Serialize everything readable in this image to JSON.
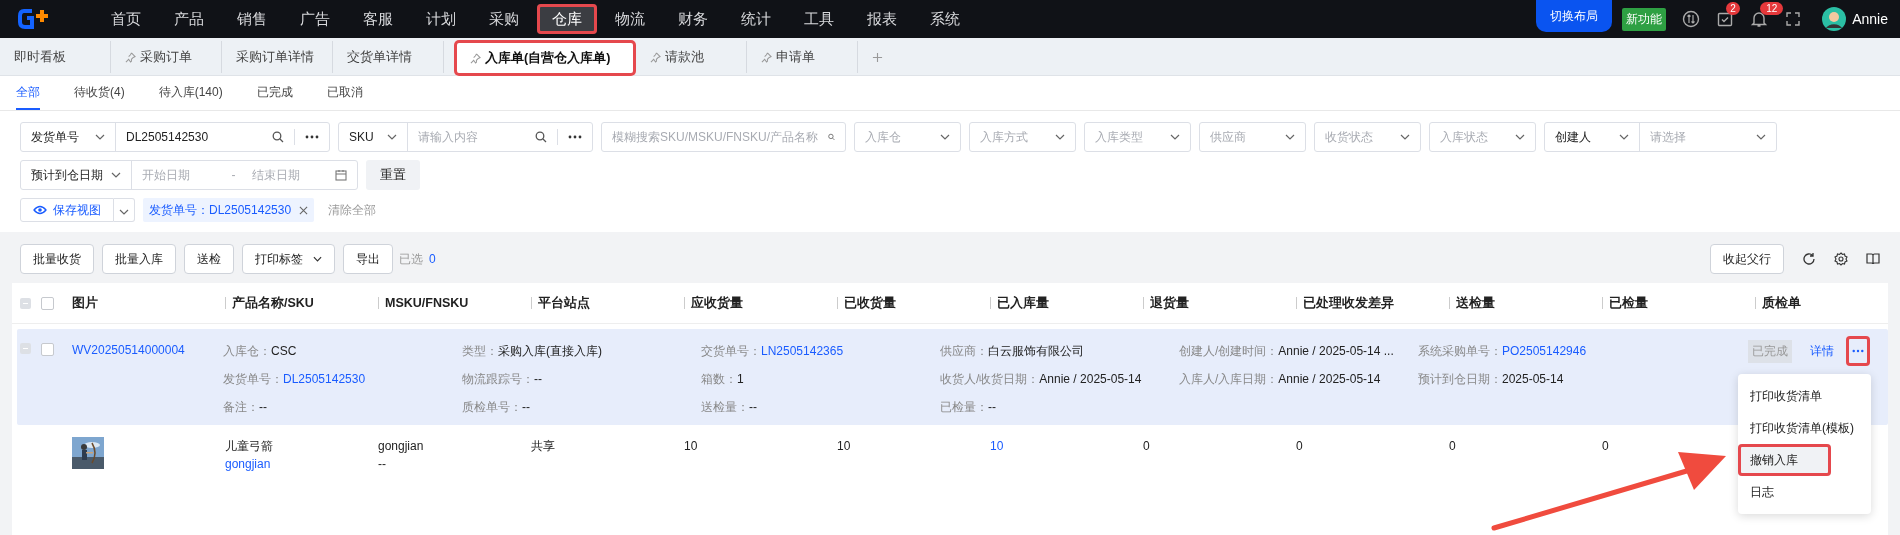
{
  "nav": {
    "items": [
      {
        "label": "首页",
        "selected": false,
        "highlighted": false
      },
      {
        "label": "产品",
        "selected": false,
        "highlighted": false
      },
      {
        "label": "销售",
        "selected": false,
        "highlighted": false
      },
      {
        "label": "广告",
        "selected": false,
        "highlighted": false
      },
      {
        "label": "客服",
        "selected": false,
        "highlighted": false
      },
      {
        "label": "计划",
        "selected": false,
        "highlighted": false
      },
      {
        "label": "采购",
        "selected": false,
        "highlighted": false
      },
      {
        "label": "仓库",
        "selected": true,
        "highlighted": true
      },
      {
        "label": "物流",
        "selected": false,
        "highlighted": false
      },
      {
        "label": "财务",
        "selected": false,
        "highlighted": false
      },
      {
        "label": "统计",
        "selected": false,
        "highlighted": false
      },
      {
        "label": "工具",
        "selected": false,
        "highlighted": false
      },
      {
        "label": "报表",
        "selected": false,
        "highlighted": false
      },
      {
        "label": "系统",
        "selected": false,
        "highlighted": false
      }
    ],
    "layout_button": "切换布局",
    "new_feature": "新功能",
    "task_badge": "2",
    "notice_badge": "12",
    "user": "Annie"
  },
  "tabs": [
    {
      "label": "即时看板",
      "pinned": false,
      "selected": false,
      "highlighted": false
    },
    {
      "label": "采购订单",
      "pinned": true,
      "selected": false,
      "highlighted": false
    },
    {
      "label": "采购订单详情",
      "pinned": false,
      "selected": false,
      "highlighted": false
    },
    {
      "label": "交货单详情",
      "pinned": false,
      "selected": false,
      "highlighted": false
    },
    {
      "label": "入库单(自营仓入库单)",
      "pinned": true,
      "selected": true,
      "highlighted": true
    },
    {
      "label": "请款池",
      "pinned": true,
      "selected": false,
      "highlighted": false
    },
    {
      "label": "申请单",
      "pinned": true,
      "selected": false,
      "highlighted": false
    }
  ],
  "status_tabs": [
    {
      "label": "全部",
      "selected": true
    },
    {
      "label": "待收货(4)",
      "selected": false
    },
    {
      "label": "待入库(140)",
      "selected": false
    },
    {
      "label": "已完成",
      "selected": false
    },
    {
      "label": "已取消",
      "selected": false
    }
  ],
  "filters": [
    [
      {
        "kind": "combo",
        "select": "发货单号",
        "value": "DL2505142530"
      },
      {
        "kind": "combo",
        "select": "SKU",
        "placeholder": "请输入内容"
      },
      {
        "kind": "search",
        "placeholder": "模糊搜索SKU/MSKU/FNSKU/产品名称"
      },
      {
        "kind": "select",
        "placeholder": "入库仓"
      },
      {
        "kind": "select",
        "placeholder": "入库方式"
      },
      {
        "kind": "select",
        "placeholder": "入库类型"
      },
      {
        "kind": "select",
        "placeholder": "供应商"
      },
      {
        "kind": "select",
        "placeholder": "收货状态"
      },
      {
        "kind": "select",
        "placeholder": "入库状态"
      },
      {
        "kind": "pair",
        "select": "创建人",
        "placeholder": "请选择"
      }
    ],
    [
      {
        "kind": "date_range",
        "select": "预计到仓日期",
        "start_placeholder": "开始日期",
        "separator": "-",
        "end_placeholder": "结束日期"
      },
      {
        "kind": "button",
        "label": "重置"
      }
    ]
  ],
  "view": {
    "save_button": "保存视图",
    "tag": "发货单号：DL2505142530",
    "clear": "清除全部"
  },
  "toolbar": {
    "buttons": [
      {
        "label": "批量收货",
        "dropdown": false
      },
      {
        "label": "批量入库",
        "dropdown": false
      },
      {
        "label": "送检",
        "dropdown": false
      },
      {
        "label": "打印标签",
        "dropdown": true
      },
      {
        "label": "导出",
        "dropdown": false
      }
    ],
    "selected_label": "已选",
    "selected_count": "0",
    "collapse_button": "收起父行"
  },
  "table": {
    "columns": [
      "图片",
      "产品名称/SKU",
      "MSKU/FNSKU",
      "平台站点",
      "应收货量",
      "已收货量",
      "已入库量",
      "退货量",
      "已处理收发差异",
      "送检量",
      "已检量",
      "质检单"
    ],
    "all_checked": false,
    "parent": {
      "code": "WV20250514000004",
      "checked": false,
      "groups": [
        [
          {
            "field": "入库仓：",
            "content": "CSC",
            "kind": "text"
          },
          {
            "field": "发货单号：",
            "content": "DL2505142530",
            "kind": "link"
          },
          {
            "field": "备注：",
            "content": "--",
            "kind": "text"
          }
        ],
        [
          {
            "field": "类型：",
            "content": "采购入库(直接入库)",
            "kind": "text"
          },
          {
            "field": "物流跟踪号：",
            "content": "--",
            "kind": "text"
          },
          {
            "field": "质检单号：",
            "content": "--",
            "kind": "text"
          }
        ],
        [
          {
            "field": "交货单号：",
            "content": "LN2505142365",
            "kind": "link"
          },
          {
            "field": "箱数：",
            "content": "1",
            "kind": "text"
          },
          {
            "field": "送检量：",
            "content": "--",
            "kind": "text"
          }
        ],
        [
          {
            "field": "供应商：",
            "content": "白云服饰有限公司",
            "kind": "text"
          },
          {
            "field": "收货人/收货日期：",
            "content": "Annie / 2025-05-14",
            "kind": "text"
          },
          {
            "field": "已检量：",
            "content": "--",
            "kind": "text"
          }
        ],
        [
          {
            "field": "创建人/创建时间：",
            "content": "Annie / 2025-05-14 ...",
            "kind": "text"
          },
          {
            "field": "入库人/入库日期：",
            "content": "Annie / 2025-05-14",
            "kind": "text"
          }
        ],
        [
          {
            "field": "系统采购单号：",
            "content": "PO2505142946",
            "kind": "link"
          },
          {
            "field": "预计到仓日期：",
            "content": "2025-05-14",
            "kind": "text"
          }
        ]
      ],
      "status": "已完成",
      "detail": "详情",
      "more_highlighted": true
    },
    "rows": [
      {
        "name": "儿童弓箭",
        "sku": "gongjian",
        "msku": "gongjian",
        "fnsku": "--",
        "site": "共享",
        "cells": [
          {
            "text": "10",
            "kind": "text"
          },
          {
            "text": "10",
            "kind": "text"
          },
          {
            "text": "10",
            "kind": "link"
          },
          {
            "text": "0",
            "kind": "text"
          },
          {
            "text": "0",
            "kind": "text"
          },
          {
            "text": "0",
            "kind": "text"
          },
          {
            "text": "0",
            "kind": "text"
          }
        ]
      }
    ]
  },
  "menu": {
    "items": [
      {
        "label": "打印收货清单",
        "hovered": false,
        "highlighted": false
      },
      {
        "label": "打印收货清单(模板)",
        "hovered": false,
        "highlighted": false
      },
      {
        "label": "撤销入库",
        "hovered": true,
        "highlighted": true
      },
      {
        "label": "日志",
        "hovered": false,
        "highlighted": false
      }
    ]
  }
}
